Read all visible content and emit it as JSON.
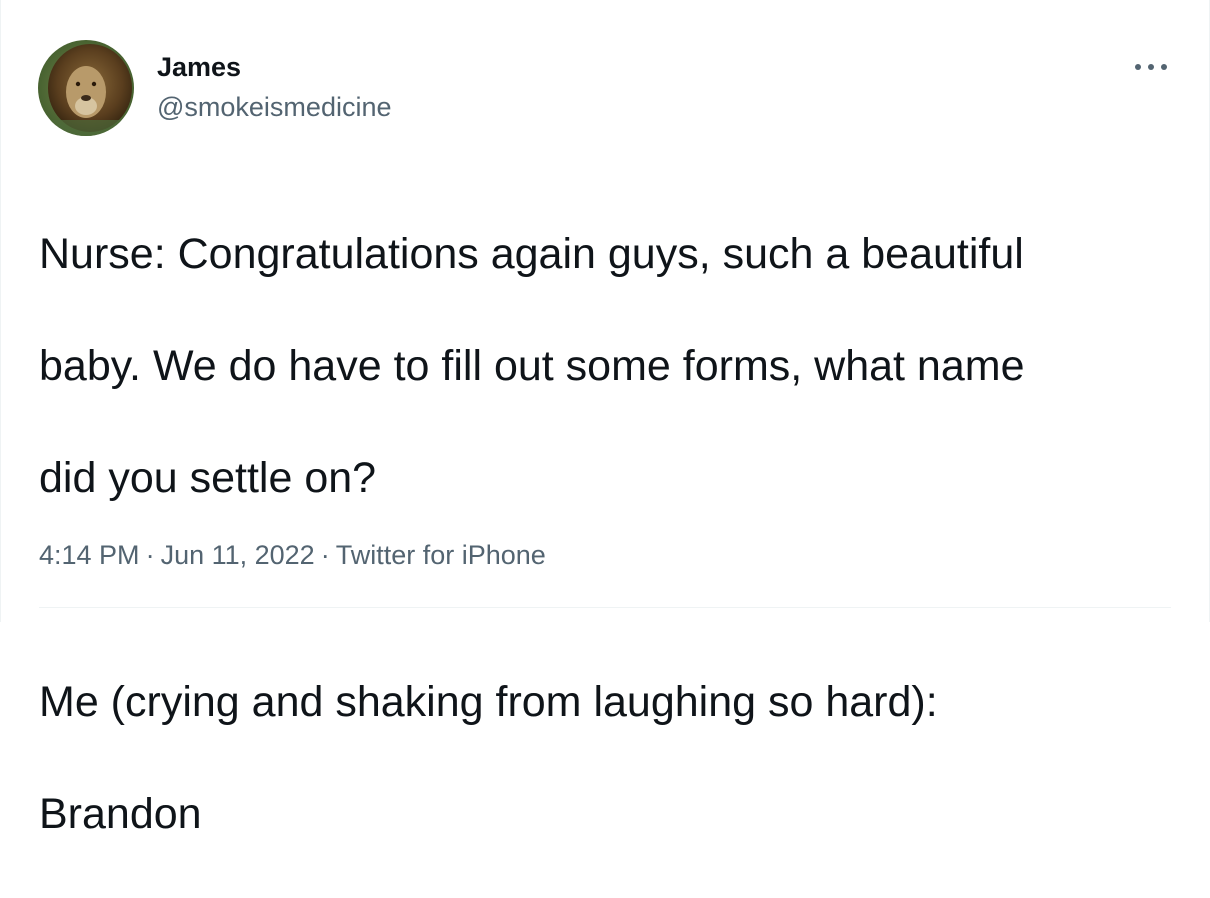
{
  "author": {
    "display_name": "James",
    "handle": "@smokeismedicine",
    "avatar_icon": "lion-avatar"
  },
  "more_menu": {
    "icon": "more-horizontal-icon"
  },
  "tweet": {
    "text_line_1": "Nurse: Congratulations again guys, such a beautiful",
    "text_line_2": "baby. We do have to fill out some forms, what name",
    "text_line_3": "did you settle on?",
    "text_line_4": "Me (crying and shaking from laughing so hard):",
    "text_line_5": "Brandon"
  },
  "meta": {
    "time": "4:14 PM",
    "separator": "·",
    "date": "Jun 11, 2022",
    "source": "Twitter for iPhone"
  },
  "colors": {
    "text_primary": "#0f1419",
    "text_secondary": "#536471",
    "divider": "#eff3f4"
  }
}
